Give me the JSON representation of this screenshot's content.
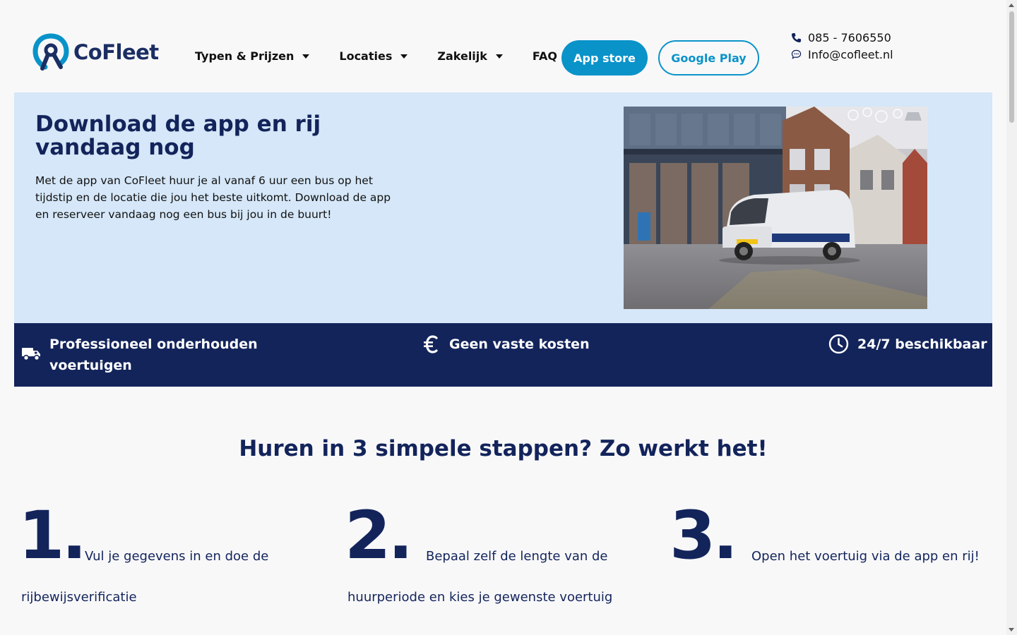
{
  "brand": {
    "name": "CoFleet",
    "accent": "#0a93c9",
    "navy": "#13245b"
  },
  "nav": {
    "items": [
      {
        "label": "Typen & Prijzen",
        "dropdown": true
      },
      {
        "label": "Locaties",
        "dropdown": true
      },
      {
        "label": "Zakelijk",
        "dropdown": true
      },
      {
        "label": "FAQ",
        "dropdown": false
      }
    ],
    "appstore_label": "App store",
    "googleplay_label": "Google Play"
  },
  "contact": {
    "phone": "085 - 7606550",
    "email": "Info@cofleet.nl"
  },
  "hero": {
    "title": "Download de app en rij vandaag nog",
    "text": "Met de app van CoFleet huur je al vanaf 6 uur een bus op het tijdstip en de locatie die jou het beste uitkomt. Download de app en reserveer vandaag nog een bus bij jou in de buurt!",
    "image_icon": "van-photo"
  },
  "usp": [
    {
      "icon": "truck-icon",
      "label": "Professioneel onderhouden voertuigen"
    },
    {
      "icon": "euro-icon",
      "label": "Geen vaste kosten"
    },
    {
      "icon": "clock-icon",
      "label": "24/7 beschikbaar"
    }
  ],
  "steps": {
    "title": "Huren in 3 simpele stappen? Zo werkt het!",
    "items": [
      {
        "number": "1",
        "line1": "Vul je gegevens in en doe de",
        "line2": "rijbewijsverificatie"
      },
      {
        "number": "2",
        "line1": "Bepaal zelf de lengte van de",
        "line2": "huurperiode en kies je gewenste voertuig"
      },
      {
        "number": "3",
        "line1": "Open het voertuig via de app en rij!",
        "line2": ""
      }
    ]
  }
}
